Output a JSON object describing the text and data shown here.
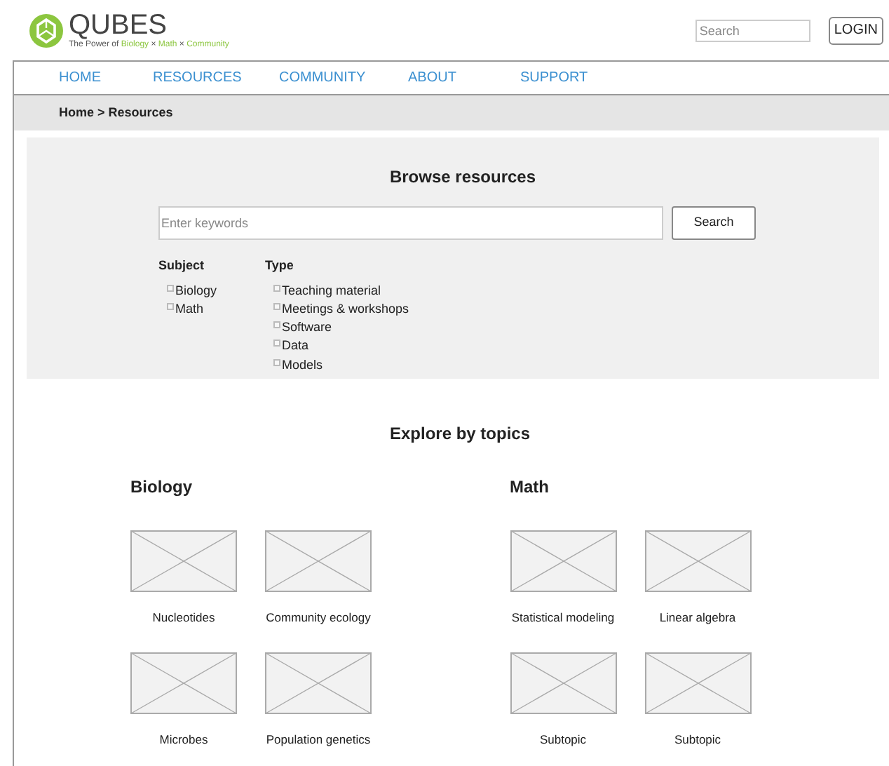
{
  "header": {
    "logo": "QUBES",
    "tagline": [
      {
        "text": "The Power of",
        "kind": "plain"
      },
      {
        "text": "Biology",
        "kind": "accent"
      },
      {
        "text": "×",
        "kind": "plain"
      },
      {
        "text": "Math",
        "kind": "accent"
      },
      {
        "text": "×",
        "kind": "plain"
      },
      {
        "text": "Community",
        "kind": "accent"
      }
    ],
    "search": {
      "placeholder": "Search"
    },
    "login": "LOGIN"
  },
  "nav": [
    "HOME",
    "RESOURCES",
    "COMMUNITY",
    "ABOUT",
    "SUPPORT"
  ],
  "breadcrumb": "Home > Resources",
  "browse": {
    "title": "Browse resources",
    "search": {
      "placeholder": "Enter keywords"
    },
    "button": "Search",
    "filters": [
      {
        "heading": "Subject",
        "options": [
          {
            "label": "Biology",
            "checked": false
          },
          {
            "label": "Math",
            "checked": false
          }
        ]
      },
      {
        "heading": "Type",
        "options": [
          {
            "label": "Teaching material",
            "checked": false
          },
          {
            "label": "Meetings & workshops",
            "checked": false
          },
          {
            "label": "Software",
            "checked": false
          },
          {
            "label": "Data",
            "checked": false
          },
          {
            "label": "Models",
            "checked": false
          }
        ]
      }
    ]
  },
  "explore": {
    "title": "Explore by topics",
    "groups": [
      {
        "heading": "Biology",
        "topics": [
          "Nucleotides",
          "Community ecology",
          "Microbes",
          "Population genetics"
        ]
      },
      {
        "heading": "Math",
        "topics": [
          "Statistical modeling",
          "Linear algebra",
          "Subtopic",
          "Subtopic"
        ]
      }
    ]
  }
}
